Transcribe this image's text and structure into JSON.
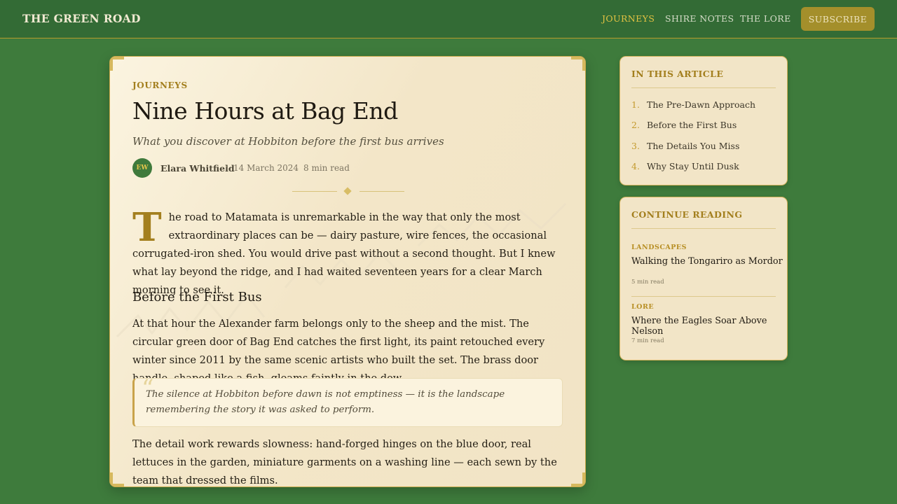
{
  "header": {
    "brand": "THE GREEN ROAD",
    "nav": [
      "JOURNEYS",
      "SHIRE NOTES",
      "THE LORE"
    ],
    "active_nav": "JOURNEYS",
    "subscribe_label": "SUBSCRIBE"
  },
  "article": {
    "category": "JOURNEYS",
    "title": "Nine Hours at Bag End",
    "subtitle": "What you discover at Hobbiton before the first bus arrives",
    "author_initials": "EW",
    "author": "Elara Whitfield",
    "date": "14 March 2024",
    "read_time": "8 min read",
    "meta_separator": "·",
    "intro_dropcap": "T",
    "intro_rest": "he road to Matamata is unremarkable in the way that only the most extraordinary places can be — dairy pasture, wire fences, the occasional corrugated-iron shed. You would drive past without a second thought. But I knew what lay beyond the ridge, and I had waited seventeen years for a clear March morning to see it.",
    "section_heading": "Before the First Bus",
    "paragraph_2": "At that hour the Alexander farm belongs only to the sheep and the mist. The circular green door of Bag End catches the first light, its paint retouched every winter since 2011 by the same scenic artists who built the set. The brass door handle, shaped like a fish, gleams faintly in the dew.",
    "quote_mark": "“",
    "pull_quote": "The silence at Hobbiton before dawn is not emptiness — it is the landscape remembering the story it was asked to perform.",
    "paragraph_3": "The detail work rewards slowness: hand-forged hinges on the blue door, real lettuces in the garden, miniature garments on a washing line — each sewn by the team that dressed the films."
  },
  "toc": {
    "heading": "IN THIS ARTICLE",
    "items": [
      {
        "num": "1.",
        "label": "The Pre-Dawn Approach"
      },
      {
        "num": "2.",
        "label": "Before the First Bus"
      },
      {
        "num": "3.",
        "label": "The Details You Miss"
      },
      {
        "num": "4.",
        "label": "Why Stay Until Dusk"
      }
    ]
  },
  "continue": {
    "heading": "CONTINUE READING",
    "items": [
      {
        "category": "LANDSCAPES",
        "title": "Walking the Tongariro as Mordor",
        "time": "5 min read"
      },
      {
        "category": "LORE",
        "title": "Where the Eagles Soar Above Nelson",
        "time": "7 min read"
      }
    ]
  },
  "colors": {
    "page_bg": "#3e7b3c",
    "topbar": "#336b35",
    "accent_gold": "#a37f1e",
    "card_cream": "#f3e6c8",
    "subscribe_bg": "#a48f2b"
  }
}
